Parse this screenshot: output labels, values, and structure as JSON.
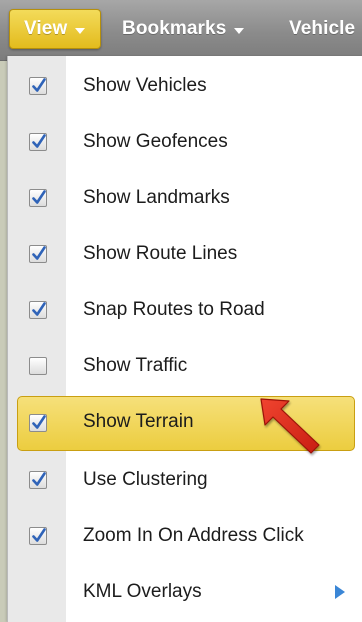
{
  "menubar": {
    "items": [
      {
        "label": "View",
        "active": true
      },
      {
        "label": "Bookmarks"
      },
      {
        "label": "Vehicle"
      }
    ]
  },
  "dropdown": {
    "items": [
      {
        "label": "Show Vehicles",
        "checked": true
      },
      {
        "label": "Show Geofences",
        "checked": true
      },
      {
        "label": "Show Landmarks",
        "checked": true
      },
      {
        "label": "Show Route Lines",
        "checked": true
      },
      {
        "label": "Snap Routes to Road",
        "checked": true
      },
      {
        "label": "Show Traffic",
        "checked": false
      },
      {
        "label": "Show Terrain",
        "checked": true,
        "highlighted": true
      },
      {
        "label": "Use Clustering",
        "checked": true
      },
      {
        "label": "Zoom In On Address Click",
        "checked": true
      },
      {
        "label": "KML Overlays",
        "submenu": true
      }
    ]
  },
  "colors": {
    "accent_yellow": "#e9c637",
    "checkmark_blue": "#2f63b8",
    "submenu_arrow": "#3a86d6",
    "annotation_red": "#e0281b"
  }
}
